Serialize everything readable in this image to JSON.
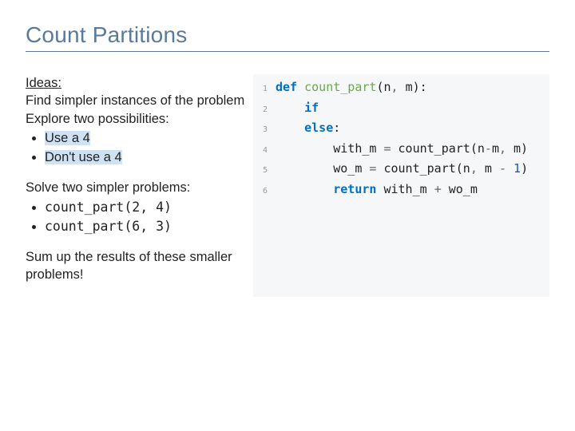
{
  "title": "Count Partitions",
  "left": {
    "ideas_heading": "Ideas:",
    "ideas_line1": "Find simpler instances of the problem",
    "ideas_line2": "Explore two possibilities:",
    "ideas_bullets": [
      "Use a 4",
      "Don't use a 4"
    ],
    "solve_heading": "Solve two simpler problems:",
    "solve_bullets": [
      "count_part(2, 4)",
      "count_part(6, 3)"
    ],
    "sum_line": "Sum up the results of these smaller problems!"
  },
  "code": {
    "lines": [
      {
        "n": "1",
        "tokens": [
          {
            "t": "def ",
            "c": "kw"
          },
          {
            "t": "count_part",
            "c": "fn"
          },
          {
            "t": "(n"
          },
          {
            "t": ", ",
            "c": "op"
          },
          {
            "t": "m):"
          }
        ]
      },
      {
        "n": "2",
        "tokens": [
          {
            "t": "    "
          },
          {
            "t": "if",
            "c": "kw"
          }
        ]
      },
      {
        "n": "3",
        "tokens": [
          {
            "t": "    "
          },
          {
            "t": "else",
            "c": "kw"
          },
          {
            "t": ":"
          }
        ]
      },
      {
        "n": "4",
        "tokens": [
          {
            "t": "        with_m "
          },
          {
            "t": "=",
            "c": "op"
          },
          {
            "t": " count_part(n"
          },
          {
            "t": "-",
            "c": "op"
          },
          {
            "t": "m"
          },
          {
            "t": ", ",
            "c": "op"
          },
          {
            "t": "m)"
          }
        ]
      },
      {
        "n": "5",
        "tokens": [
          {
            "t": "        wo_m "
          },
          {
            "t": "=",
            "c": "op"
          },
          {
            "t": " count_part(n"
          },
          {
            "t": ", ",
            "c": "op"
          },
          {
            "t": "m "
          },
          {
            "t": "- ",
            "c": "op"
          },
          {
            "t": "1",
            "c": "num"
          },
          {
            "t": ")"
          }
        ]
      },
      {
        "n": "6",
        "tokens": [
          {
            "t": "        "
          },
          {
            "t": "return",
            "c": "kw"
          },
          {
            "t": " with_m "
          },
          {
            "t": "+",
            "c": "op"
          },
          {
            "t": " wo_m"
          }
        ]
      }
    ]
  }
}
